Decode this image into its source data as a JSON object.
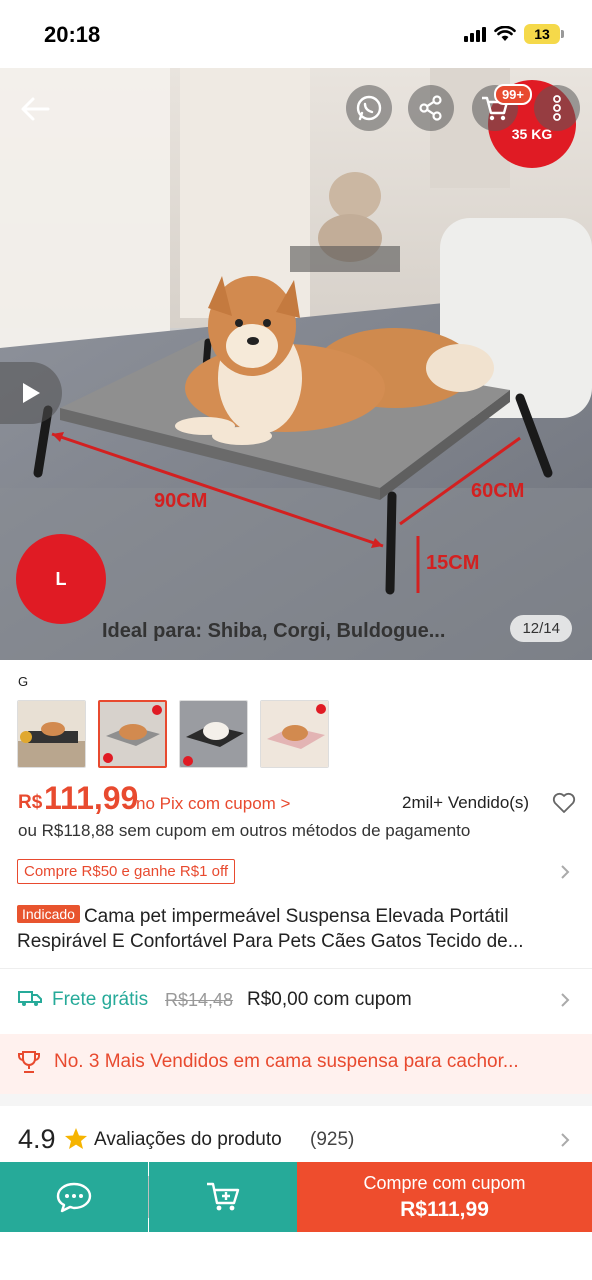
{
  "status_bar": {
    "time": "20:18",
    "battery": "13"
  },
  "hero": {
    "weight_badge": "35 KG",
    "cart_count": "99+",
    "size_badge": "L",
    "caption": "Ideal para: Shiba, Corgi, Buldogue...",
    "page_counter": "12/14",
    "dim_width": "90CM",
    "dim_depth": "60CM",
    "dim_height": "15CM",
    "icons": [
      "back-arrow-icon",
      "whatsapp-icon",
      "share-icon",
      "cart-icon",
      "more-icon",
      "play-icon"
    ]
  },
  "variant": {
    "name": "G",
    "selected_index": 1,
    "thumb_count": 4
  },
  "price": {
    "currency": "R$",
    "value": "111,99",
    "pix_text": "no Pix com cupom >",
    "sold": "2mil+ Vendido(s)",
    "alt_text": "ou R$118,88 sem cupom em outros métodos de pagamento"
  },
  "coupon": {
    "text": "Compre R$50 e ganhe R$1 off"
  },
  "title": {
    "tag": "Indicado",
    "line1": "Cama pet impermeável Suspensa Elevada Portátil",
    "line2": "Respirável E Confortável Para Pets Cães Gatos Tecido de..."
  },
  "shipping": {
    "free": "Frete grátis",
    "old": "R$14,48",
    "new": "R$0,00 com cupom"
  },
  "best_seller": {
    "text": "No. 3 Mais Vendidos em cama suspensa para cachor..."
  },
  "rating": {
    "score": "4.9",
    "label": "Avaliações do produto",
    "count": "(925)"
  },
  "bottom_bar": {
    "buy_label": "Compre com cupom",
    "buy_price": "R$111,99"
  },
  "colors": {
    "accent": "#ee4d2d",
    "teal": "#26aa99",
    "badge_red": "#e01b24"
  }
}
